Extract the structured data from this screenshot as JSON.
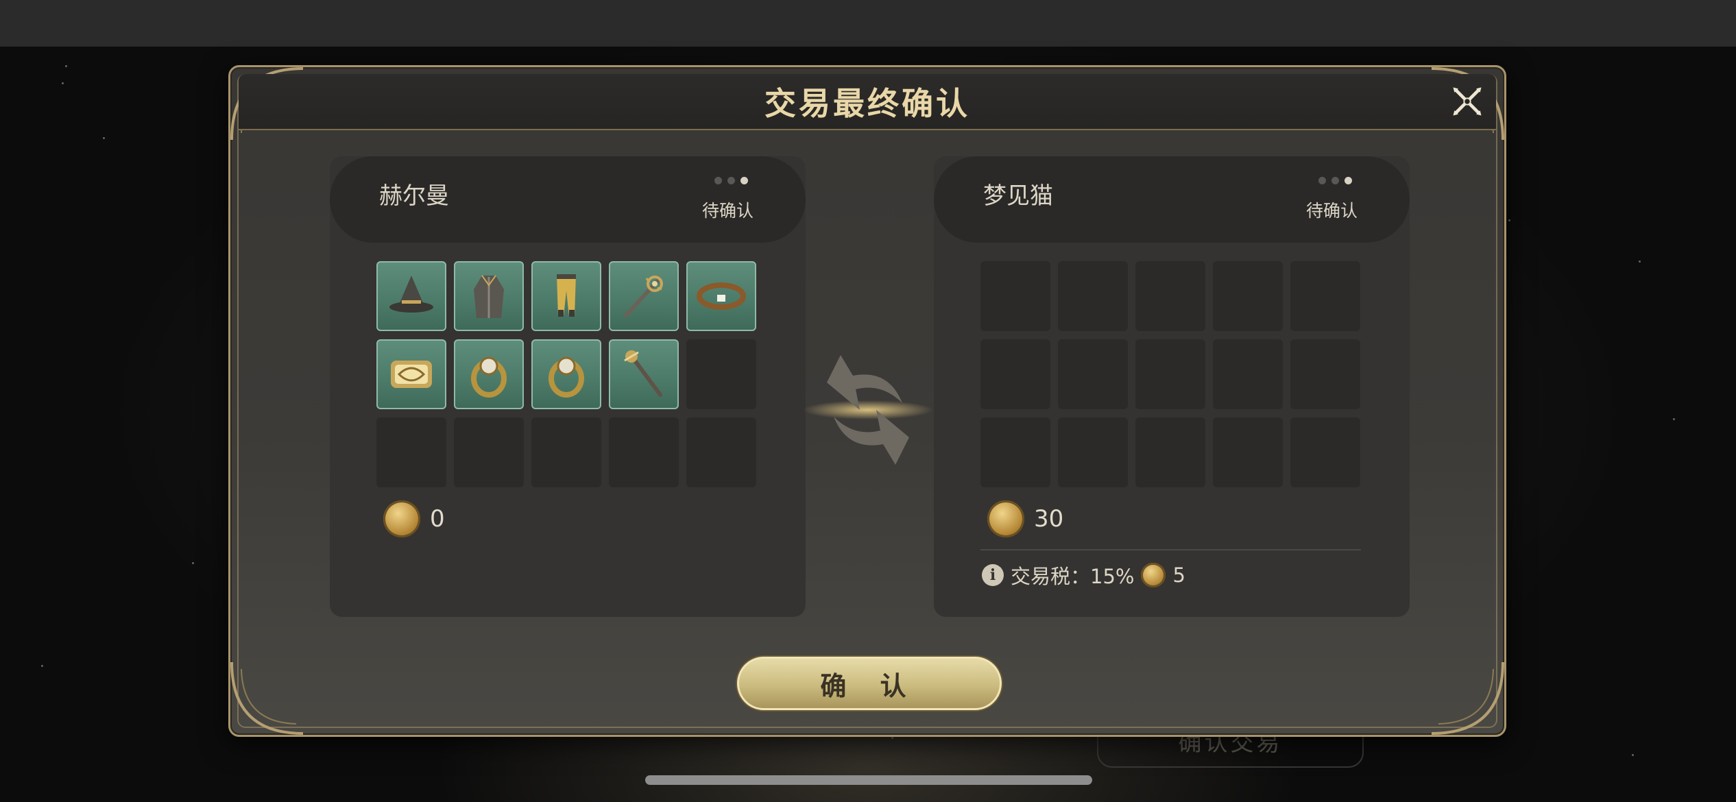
{
  "dialog": {
    "title": "交易最终确认",
    "confirm_label": "确 认"
  },
  "background": {
    "button_label": "确认交易"
  },
  "left_player": {
    "name": "赫尔曼",
    "status": "待确认",
    "status_dots_active": 1,
    "items": [
      {
        "icon": "witch-hat-icon"
      },
      {
        "icon": "robe-icon"
      },
      {
        "icon": "leggings-icon"
      },
      {
        "icon": "ornate-wand-icon"
      },
      {
        "icon": "bracelet-icon"
      },
      {
        "icon": "bracer-icon"
      },
      {
        "icon": "ring-icon"
      },
      {
        "icon": "ring-icon"
      },
      {
        "icon": "staff-icon"
      }
    ],
    "slots_total": 15,
    "gold": "0"
  },
  "right_player": {
    "name": "梦见猫",
    "status": "待确认",
    "status_dots_active": 1,
    "items": [],
    "slots_total": 15,
    "gold": "30",
    "tax_label": "交易税：15%",
    "tax_amount": "5"
  },
  "colors": {
    "accent_gold": "#a8946a",
    "item_slot_green": "#5f8d7b",
    "confirm_button": "#cbbb7e"
  }
}
